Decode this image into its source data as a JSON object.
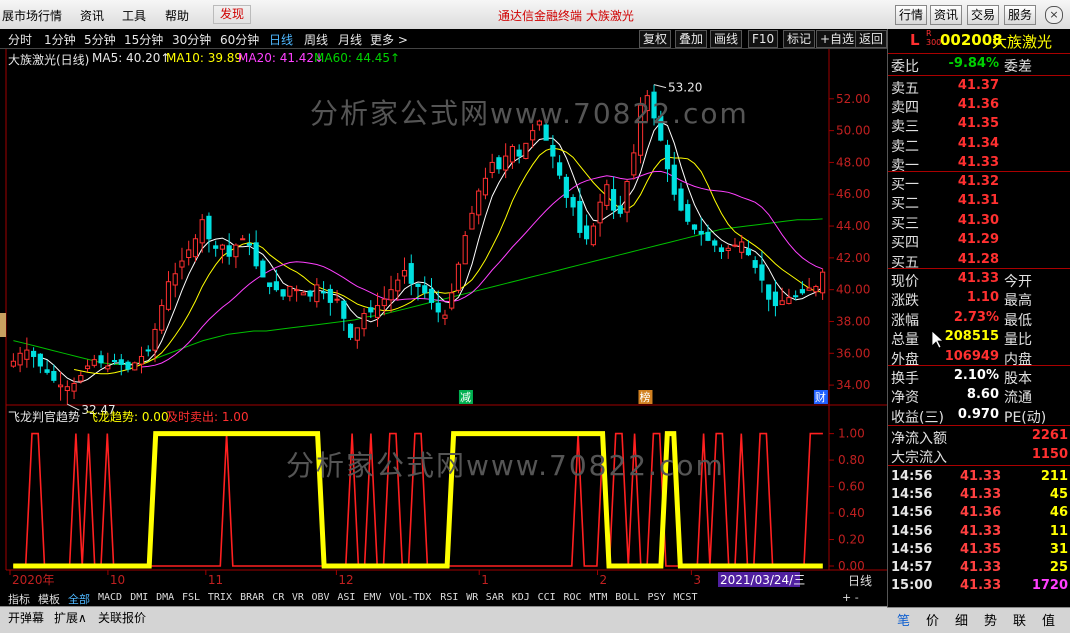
{
  "menubar": {
    "items": [
      "展市场行情",
      "资讯",
      "工具",
      "帮助"
    ],
    "hot": "发现",
    "center_title": "通达信金融终端   大族激光",
    "right_buttons": [
      "行情",
      "资讯",
      "交易",
      "服务"
    ]
  },
  "periodbar": {
    "periods": [
      "分时",
      "1分钟",
      "5分钟",
      "15分钟",
      "30分钟",
      "60分钟",
      "日线",
      "周线",
      "月线",
      "更多 >"
    ],
    "active": "日线",
    "right_buttons": [
      "复权",
      "叠加",
      "画线",
      "F10",
      "标记",
      "+自选",
      "返回"
    ]
  },
  "indicators": {
    "title": "大族激光(日线)",
    "ma5": "MA5: 40.20↑",
    "ma10": "MA10: 39.89",
    "ma20": "MA20: 41.42↓",
    "ma60": "MA60: 44.45↑",
    "sub_title": "飞龙判官趋势",
    "sub_a": "飞龙趋势: 0.00",
    "sub_b": "及时卖出: 1.00"
  },
  "chart_data": [
    {
      "type": "candlestick",
      "title": "大族激光(日线)",
      "yticks": [
        "52.00",
        "50.00",
        "48.00",
        "46.00",
        "44.00",
        "42.00",
        "40.00",
        "38.00",
        "36.00",
        "34.00"
      ],
      "ylim": [
        33.0,
        54.0
      ],
      "annotations": [
        "53.20",
        "32.47"
      ],
      "markers": [
        "减",
        "榜",
        "财"
      ],
      "x_labels": [
        "2020年",
        "10",
        "11",
        "12",
        "1",
        "2",
        "3"
      ],
      "date_label": "2021/03/24/三",
      "period_label": "日线",
      "colors": {
        "up": "#ff3030",
        "down": "#00e0e0",
        "ma5": "#ffffff",
        "ma10": "#ffff00",
        "ma20": "#ff40ff",
        "ma60": "#00c000"
      },
      "closes": [
        35.5,
        36.0,
        36.2,
        35.8,
        35.2,
        34.8,
        34.3,
        34.0,
        33.9,
        34.1,
        34.6,
        35.2,
        35.6,
        35.4,
        35.2,
        35.5,
        35.3,
        35.0,
        35.4,
        35.8,
        36.2,
        37.5,
        39.0,
        40.5,
        41.0,
        41.8,
        42.5,
        43.2,
        44.4,
        43.2,
        42.6,
        42.8,
        42.1,
        42.8,
        43.2,
        42.8,
        41.5,
        40.8,
        40.2,
        40.0,
        39.6,
        40.2,
        40.0,
        39.8,
        39.6,
        40.3,
        39.8,
        39.2,
        39.4,
        38.2,
        37.0,
        37.6,
        38.5,
        38.6,
        39.0,
        39.4,
        40.0,
        40.6,
        41.2,
        40.4,
        40.2,
        39.8,
        39.2,
        38.6,
        38.4,
        39.8,
        41.6,
        43.4,
        44.8,
        46.2,
        47.0,
        48.0,
        47.6,
        48.4,
        49.0,
        48.4,
        49.2,
        50.0,
        50.6,
        49.4,
        48.4,
        47.2,
        45.8,
        45.2,
        43.6,
        43.2,
        44.0,
        45.5,
        46.6,
        45.0,
        44.8,
        46.8,
        48.6,
        51.6,
        52.2,
        50.8,
        49.4,
        47.6,
        46.0,
        45.0,
        44.3,
        43.8,
        43.5,
        43.1,
        42.8,
        42.4,
        42.6,
        42.8,
        43.0,
        42.2,
        41.4,
        40.6,
        39.4,
        39.0,
        39.3,
        39.5,
        39.6,
        39.8,
        40.1,
        40.2,
        41.1
      ],
      "ma60": [
        36.8,
        36.6,
        36.4,
        36.2,
        36.0,
        35.8,
        35.6,
        35.4,
        35.3,
        35.3,
        35.4,
        35.6,
        35.9,
        36.2,
        36.5,
        36.8,
        37.0,
        37.2,
        37.3,
        37.4,
        37.4,
        37.5,
        37.6,
        37.7,
        37.8,
        37.9,
        38.0,
        38.1,
        38.3,
        38.4,
        38.6,
        38.8,
        39.0,
        39.2,
        39.4,
        39.6,
        39.8,
        40.0,
        40.2,
        40.4,
        40.6,
        40.8,
        41.0,
        41.2,
        41.4,
        41.6,
        41.8,
        42.0,
        42.2,
        42.4,
        42.6,
        42.8,
        43.0,
        43.2,
        43.4,
        43.6,
        43.8,
        43.9,
        44.0,
        44.1,
        44.2,
        44.3,
        44.4,
        44.4,
        44.45
      ],
      "ma60_start_index": 55
    },
    {
      "type": "line",
      "title": "飞龙判官趋势",
      "series": [
        {
          "name": "飞龙趋势",
          "color": "#ffff00"
        },
        {
          "name": "及时卖出",
          "color": "#ff2020"
        }
      ],
      "yticks": [
        "1.00",
        "0.80",
        "0.60",
        "0.40",
        "0.20",
        "0.00"
      ],
      "ylim": [
        0,
        1.05
      ],
      "yellow": [
        0,
        0,
        0,
        0,
        0,
        0,
        0,
        0,
        0,
        0,
        0,
        0,
        0,
        0,
        0,
        0,
        0,
        0,
        0,
        0,
        0,
        0,
        1,
        1,
        1,
        1,
        1,
        1,
        1,
        1,
        1,
        1,
        1,
        1,
        1,
        1,
        1,
        1,
        1,
        1,
        1,
        1,
        1,
        1,
        1,
        1,
        1,
        1,
        0,
        0,
        0,
        0,
        0,
        0,
        0,
        0,
        0,
        0,
        0,
        0,
        0,
        0,
        0,
        0,
        0,
        0,
        0,
        0,
        1,
        1,
        1,
        1,
        1,
        1,
        1,
        1,
        1,
        1,
        1,
        1,
        1,
        1,
        1,
        1,
        1,
        1,
        1,
        1,
        1,
        1,
        1,
        1,
        0,
        0,
        0,
        0,
        0,
        0,
        0,
        0,
        0,
        1,
        1,
        0,
        0,
        0,
        0,
        0,
        0,
        0,
        0,
        0,
        0,
        0,
        0,
        0,
        0,
        0,
        0,
        0,
        0,
        0,
        0,
        0,
        0,
        0
      ],
      "red": [
        0,
        0,
        0,
        1,
        1,
        0,
        0,
        0,
        0,
        0,
        1,
        0,
        1,
        0,
        0,
        1,
        0,
        0,
        0,
        0,
        0,
        0,
        0,
        0,
        0,
        0,
        0,
        0,
        0,
        0,
        0,
        0,
        0,
        0,
        1,
        0,
        0,
        0,
        0,
        0,
        0,
        0,
        0,
        0,
        0,
        0,
        0,
        0,
        0,
        0,
        0,
        0,
        0,
        0,
        1,
        0,
        0,
        1,
        0,
        0,
        1,
        1,
        0,
        0,
        1,
        1,
        0,
        0,
        0,
        0,
        0,
        0,
        0,
        0,
        0,
        0,
        0,
        0,
        0,
        0,
        0,
        0,
        0,
        0,
        0,
        0,
        0,
        0,
        0,
        0,
        1,
        0,
        0,
        0,
        1,
        0,
        1,
        1,
        0,
        1,
        0,
        0,
        1,
        1,
        0,
        0,
        0,
        0,
        0,
        0,
        1,
        0,
        1,
        1,
        0,
        0,
        1,
        0,
        0,
        1,
        1,
        0,
        0,
        0,
        0,
        0,
        0,
        1,
        1,
        1
      ]
    }
  ],
  "tabs": {
    "items": [
      "指标",
      "模板",
      "全部",
      "MACD",
      "DMI",
      "DMA",
      "FSL",
      "TRIX",
      "BRAR",
      "CR",
      "VR",
      "OBV",
      "ASI",
      "EMV",
      "VOL-TDX",
      "RSI",
      "WR",
      "SAR",
      "KDJ",
      "CCI",
      "ROC",
      "MTM",
      "BOLL",
      "PSY",
      "MCST"
    ],
    "active": "全部",
    "plusminus": "+  -"
  },
  "bottombar": {
    "items": [
      "开弹幕",
      "扩展∧",
      "关联报价"
    ]
  },
  "quote": {
    "flag": "L",
    "r300": "R\n300",
    "code": "002008",
    "name": "大族激光",
    "weibi_label": "委比",
    "weibi": "-9.84%",
    "weicha_label": "委差",
    "sell": [
      {
        "label": "卖五",
        "price": "41.37"
      },
      {
        "label": "卖四",
        "price": "41.36"
      },
      {
        "label": "卖三",
        "price": "41.35"
      },
      {
        "label": "卖二",
        "price": "41.34"
      },
      {
        "label": "卖一",
        "price": "41.33"
      }
    ],
    "buy": [
      {
        "label": "买一",
        "price": "41.32"
      },
      {
        "label": "买二",
        "price": "41.31"
      },
      {
        "label": "买三",
        "price": "41.30"
      },
      {
        "label": "买四",
        "price": "41.29"
      },
      {
        "label": "买五",
        "price": "41.28"
      }
    ],
    "stats": [
      {
        "l": "现价",
        "v": "41.33",
        "l2": "今开",
        "cls": "red"
      },
      {
        "l": "涨跌",
        "v": "1.10",
        "l2": "最高",
        "cls": "red"
      },
      {
        "l": "涨幅",
        "v": "2.73%",
        "l2": "最低",
        "cls": "red"
      },
      {
        "l": "总量",
        "v": "208515",
        "l2": "量比",
        "cls": "yellow"
      },
      {
        "l": "外盘",
        "v": "106949",
        "l2": "内盘",
        "cls": "red"
      }
    ],
    "stats2": [
      {
        "l": "换手",
        "v": "2.10%",
        "l2": "股本",
        "cls": "white"
      },
      {
        "l": "净资",
        "v": "8.60",
        "l2": "流通",
        "cls": "white"
      },
      {
        "l": "收益(三)",
        "v": "0.970",
        "l2": "PE(动)",
        "cls": "white"
      }
    ],
    "flows": [
      {
        "l": "净流入额",
        "v": "2261"
      },
      {
        "l": "大宗流入",
        "v": "1150"
      }
    ],
    "ticks": [
      {
        "t": "14:56",
        "p": "41.33",
        "q": "211"
      },
      {
        "t": "14:56",
        "p": "41.33",
        "q": "45"
      },
      {
        "t": "14:56",
        "p": "41.36",
        "q": "46"
      },
      {
        "t": "14:56",
        "p": "41.33",
        "q": "11"
      },
      {
        "t": "14:56",
        "p": "41.35",
        "q": "31"
      },
      {
        "t": "14:57",
        "p": "41.33",
        "q": "25"
      },
      {
        "t": "15:00",
        "p": "41.33",
        "q": "1720"
      }
    ],
    "bottom_tabs": [
      "笔",
      "价",
      "细",
      "势",
      "联",
      "值"
    ]
  },
  "watermark": "分析家公式网www.70822.com"
}
